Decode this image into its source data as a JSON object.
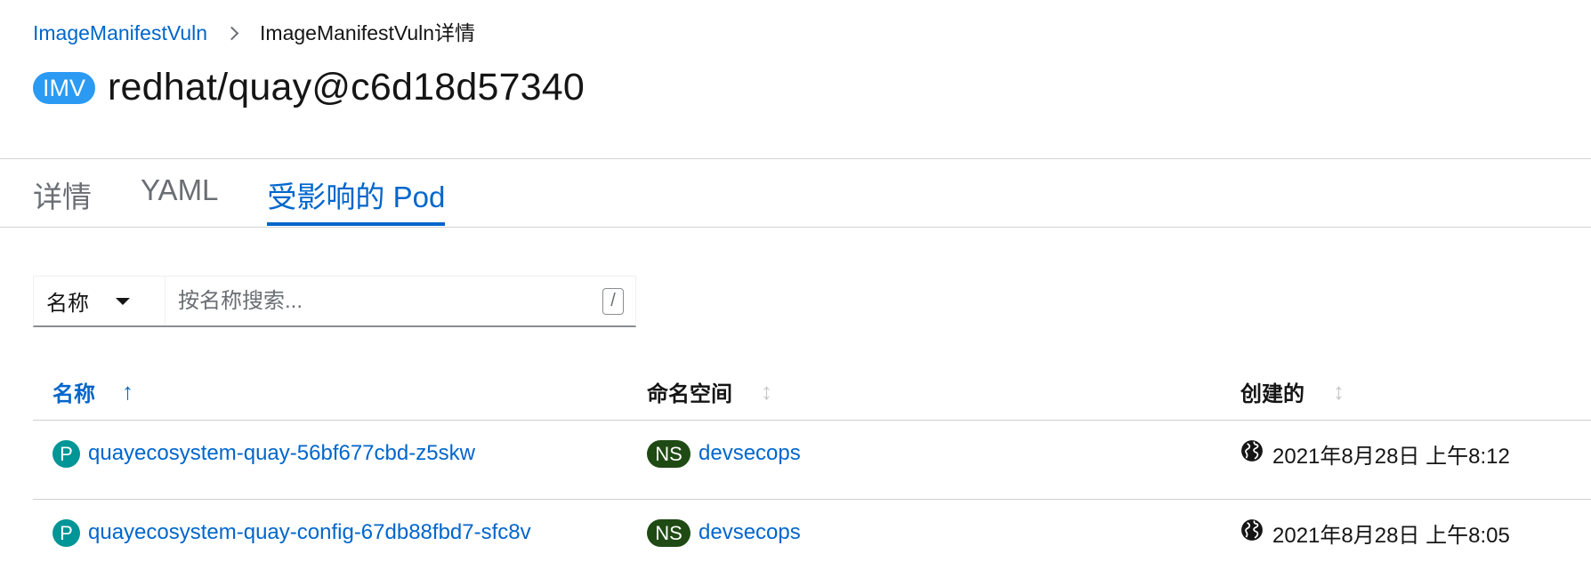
{
  "breadcrumb": {
    "parent": "ImageManifestVuln",
    "current": "ImageManifestVuln详情"
  },
  "header": {
    "badge": "IMV",
    "title": "redhat/quay@c6d18d57340"
  },
  "tabs": [
    {
      "label": "详情",
      "active": false
    },
    {
      "label": "YAML",
      "active": false
    },
    {
      "label": "受影响的 Pod",
      "active": true
    }
  ],
  "filter": {
    "selected": "名称",
    "placeholder": "按名称搜索...",
    "shortcut": "/"
  },
  "table": {
    "columns": [
      {
        "label": "名称",
        "sort": "ascending"
      },
      {
        "label": "命名空间",
        "sort": "none"
      },
      {
        "label": "创建的",
        "sort": "none"
      }
    ],
    "rows": [
      {
        "pod_badge": "P",
        "pod": "quayecosystem-quay-56bf677cbd-z5skw",
        "ns_badge": "NS",
        "namespace": "devsecops",
        "created": "2021年8月28日 上午8:12"
      },
      {
        "pod_badge": "P",
        "pod": "quayecosystem-quay-config-67db88fbd7-sfc8v",
        "ns_badge": "NS",
        "namespace": "devsecops",
        "created": "2021年8月28日 上午8:05"
      }
    ]
  },
  "colors": {
    "link": "#0066cc",
    "imv_badge": "#2b9af3",
    "pod_badge": "#009596",
    "ns_badge": "#1f4a14"
  }
}
